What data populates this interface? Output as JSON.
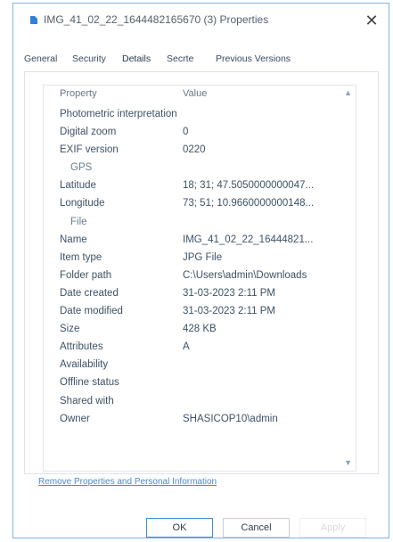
{
  "window": {
    "title": "IMG_41_02_22_1644482165670 (3) Properties"
  },
  "tabs": [
    {
      "label": "General"
    },
    {
      "label": "Security"
    },
    {
      "label": "Details"
    },
    {
      "label": "Secrte"
    },
    {
      "label": "Previous Versions"
    }
  ],
  "details": {
    "header": {
      "property": "Property",
      "value": "Value"
    },
    "rows": [
      {
        "property": "Photometric interpretation",
        "value": ""
      },
      {
        "property": "Digital zoom",
        "value": "0"
      },
      {
        "property": "EXIF version",
        "value": "0220"
      },
      {
        "property": "GPS",
        "value": ""
      },
      {
        "property": "Latitude",
        "value": "18; 31; 47.5050000000047..."
      },
      {
        "property": "Longitude",
        "value": "73; 51; 10.9660000000148..."
      },
      {
        "property": "File",
        "value": ""
      },
      {
        "property": "Name",
        "value": "IMG_41_02_22_16444821..."
      },
      {
        "property": "Item type",
        "value": "JPG File"
      },
      {
        "property": "Folder path",
        "value": "C:\\Users\\admin\\Downloads"
      },
      {
        "property": "Date created",
        "value": "31-03-2023 2:11 PM"
      },
      {
        "property": "Date modified",
        "value": "31-03-2023 2:11 PM"
      },
      {
        "property": "Size",
        "value": "428 KB"
      },
      {
        "property": "Attributes",
        "value": "A"
      },
      {
        "property": "Availability",
        "value": ""
      },
      {
        "property": "Offline status",
        "value": ""
      },
      {
        "property": "Shared with",
        "value": ""
      },
      {
        "property": "Owner",
        "value": "SHASICOP10\\admin"
      }
    ]
  },
  "remove_link": "Remove Properties and Personal Information",
  "buttons": {
    "ok": "OK",
    "cancel": "Cancel",
    "apply": "Apply"
  },
  "colors": {
    "accent": "#3b8fdc",
    "link": "#4a8ad0",
    "text": "#3d5166"
  }
}
